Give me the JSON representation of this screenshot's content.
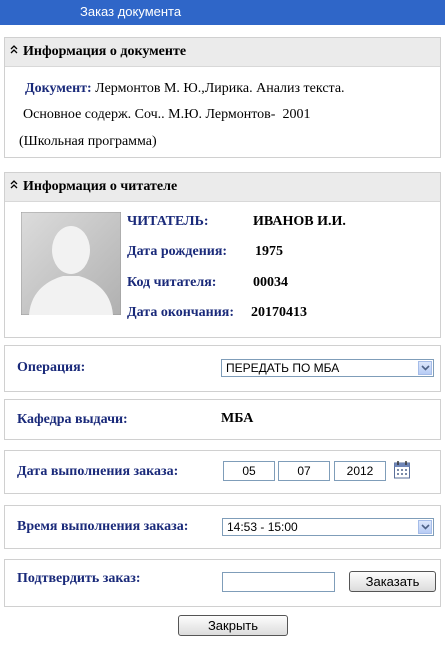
{
  "window": {
    "title": "Заказ документа"
  },
  "doc_panel": {
    "title": "Информация о документе",
    "doc_label": "Документ:",
    "line1": "Лермонтов М. Ю.,Лирика. Анализ текста.",
    "line2": "Основное содерж. Соч.. М.Ю. Лермонтов-  2001",
    "line3": "(Школьная программа)"
  },
  "reader_panel": {
    "title": "Информация о читателе",
    "reader_label": "ЧИТАТЕЛЬ:",
    "reader_value": "ИВАНОВ И.И.",
    "birth_label": "Дата рождения:",
    "birth_value": "1975",
    "code_label": "Код читателя:",
    "code_value": "00034",
    "end_label": "Дата окончания:",
    "end_value": "20170413"
  },
  "operation": {
    "label": "Операция:",
    "value": "ПЕРЕДАТЬ ПО МБА"
  },
  "department": {
    "label": "Кафедра выдачи:",
    "value": "МБА"
  },
  "order_date": {
    "label": "Дата выполнения заказа:",
    "day": "05",
    "month": "07",
    "year": "2012"
  },
  "order_time": {
    "label": "Время выполнения заказа:",
    "value": "14:53 - 15:00"
  },
  "confirm": {
    "label": "Подтвердить заказ:",
    "input_value": "",
    "button": "Заказать"
  },
  "close_button": "Закрыть"
}
